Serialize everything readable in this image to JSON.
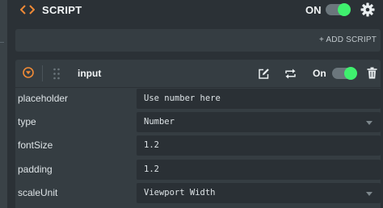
{
  "header": {
    "title": "SCRIPT",
    "toggle_label": "ON",
    "toggle_on": true,
    "accent_color": "#f08a36",
    "toggle_color": "#3ff06e",
    "icons": [
      "code-brackets-icon",
      "gear-icon"
    ]
  },
  "actions": {
    "add_script_label": "+ ADD SCRIPT"
  },
  "script": {
    "name": "input",
    "toggle_label": "On",
    "toggle_on": true,
    "icons": [
      "collapse-icon",
      "drag-handle-icon",
      "edit-icon",
      "swap-icon",
      "trash-icon"
    ],
    "properties": [
      {
        "label": "placeholder",
        "value": "Use number here",
        "type": "text"
      },
      {
        "label": "type",
        "value": "Number",
        "type": "select"
      },
      {
        "label": "fontSize",
        "value": "1.2",
        "type": "text"
      },
      {
        "label": "padding",
        "value": "1.2",
        "type": "text"
      },
      {
        "label": "scaleUnit",
        "value": "Viewport Width",
        "type": "select"
      }
    ]
  }
}
